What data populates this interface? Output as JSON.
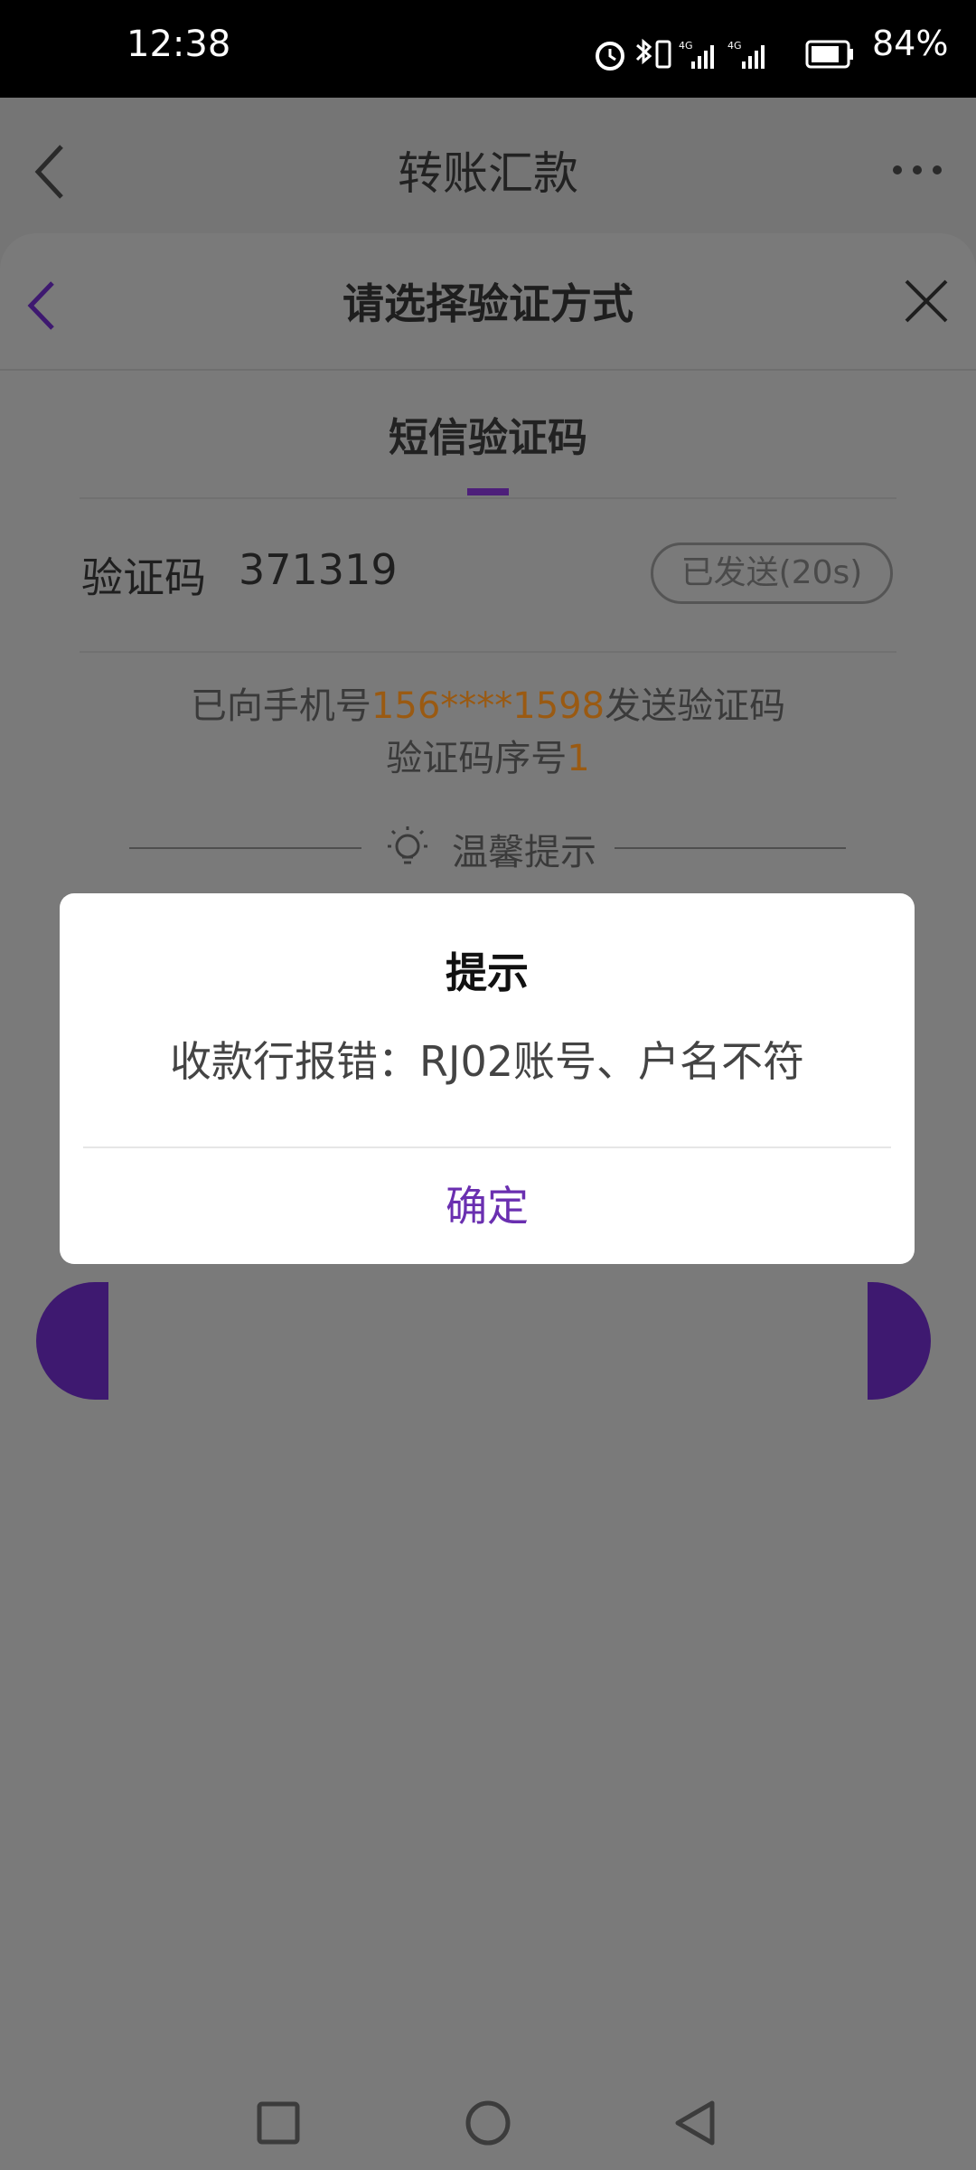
{
  "status_bar": {
    "time": "12:38",
    "battery": "84%",
    "network_labels": [
      "4G",
      "4G"
    ]
  },
  "base_page": {
    "title": "转账汇款",
    "back_icon": "chevron-left-icon",
    "more_icon": "more-horizontal-icon"
  },
  "sheet": {
    "title": "请选择验证方式",
    "back_icon": "chevron-left-icon",
    "close_icon": "close-icon",
    "tab_label": "短信验证码",
    "code_label": "验证码",
    "code_value": "371319",
    "resend_label": "已发送(20s)",
    "info_prefix": "已向手机号",
    "phone_masked": "156****1598",
    "info_suffix": "发送验证码",
    "sequence_prefix": "验证码序号",
    "sequence_number": "1",
    "tip_label": "温馨提示",
    "tip_icon": "lightbulb-icon",
    "accent_color": "#4d1f7a"
  },
  "dialog": {
    "title": "提示",
    "message": "收款行报错：RJ02账号、户名不符",
    "confirm_label": "确定",
    "confirm_color": "#6a2fb0"
  },
  "nav_bar": {
    "icons": [
      "recent-apps-icon",
      "home-icon",
      "back-icon"
    ]
  }
}
